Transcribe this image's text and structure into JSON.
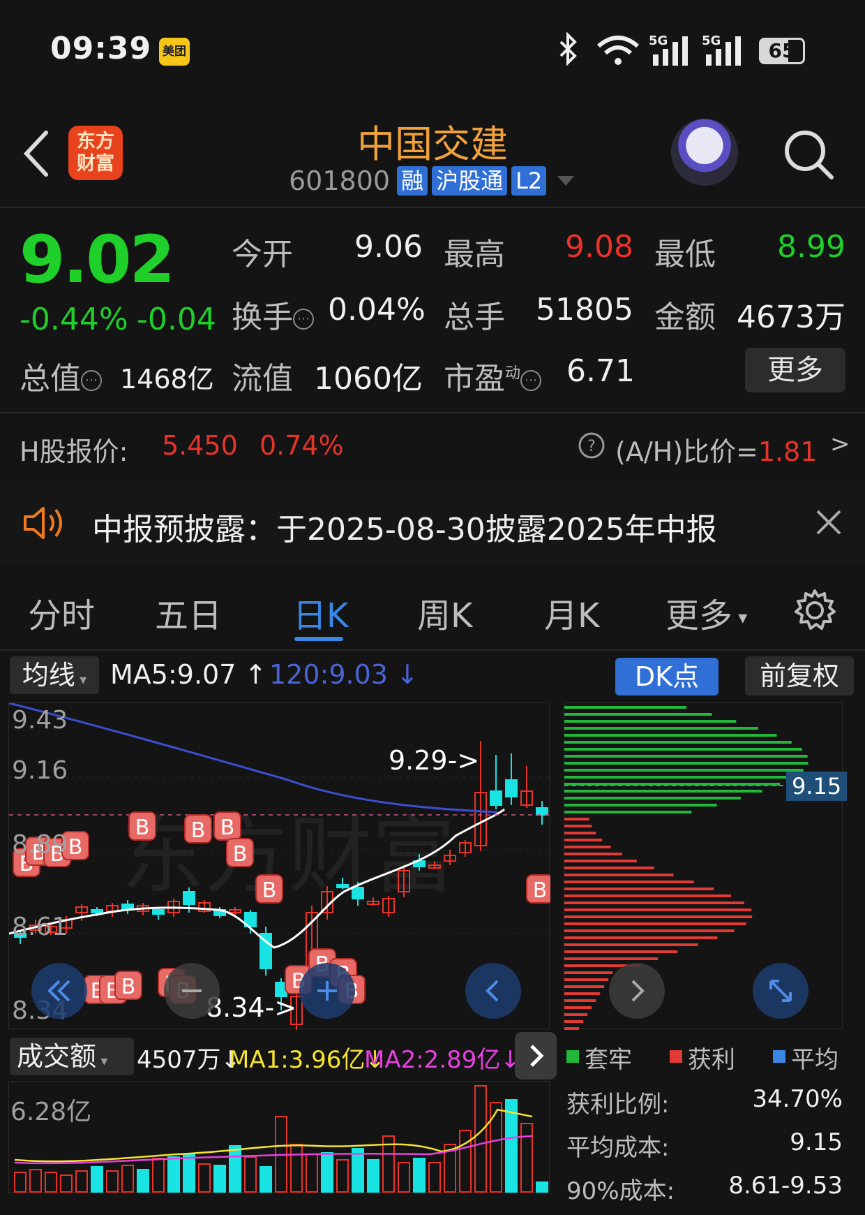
{
  "status_bar": {
    "time": "09:39",
    "app_badge": "美团",
    "battery": "65",
    "battery_level": 0.65,
    "net1": "5G",
    "net2": "5G"
  },
  "header": {
    "logo_line1": "东方",
    "logo_line2": "财富",
    "stock_name": "中国交建",
    "stock_code": "601800",
    "tags": [
      "融",
      "沪股通",
      "L2"
    ]
  },
  "quote": {
    "price": "9.02",
    "change_pct": "-0.44%",
    "change": "-0.04",
    "open_label": "今开",
    "open": "9.06",
    "high_label": "最高",
    "high": "9.08",
    "low_label": "最低",
    "low": "8.99",
    "turnover_label": "换手",
    "turnover": "0.04%",
    "volume_label": "总手",
    "volume": "51805",
    "amount_label": "金额",
    "amount": "4673万",
    "mktcap_label": "总值",
    "mktcap": "1468亿",
    "float_label": "流值",
    "float_cap": "1060亿",
    "pe_label": "市盈",
    "pe_sup": "动",
    "pe": "6.71",
    "more_label": "更多"
  },
  "hshare": {
    "label": "H股报价:",
    "price": "5.450",
    "pct": "0.74%",
    "ah_label": "(A/H)比价=",
    "ah_value": "1.81",
    "arrow": ">"
  },
  "notice": {
    "text": "中报预披露：于2025-08-30披露2025年中报"
  },
  "tabs": [
    {
      "label": "分时"
    },
    {
      "label": "五日"
    },
    {
      "label": "日K"
    },
    {
      "label": "周K"
    },
    {
      "label": "月K"
    },
    {
      "label": "更多"
    }
  ],
  "chart_controls": {
    "ma_selector": "均线",
    "ma5": "MA5:9.07 ↑",
    "ma120": "120:9.03 ↓",
    "dk_button": "DK点",
    "adjust_button": "前复权"
  },
  "kline_labels": {
    "y_top": "9.43",
    "y2": "9.16",
    "y3": "8.89",
    "y4": "8.61",
    "y_bottom": "8.34",
    "max_marker": "9.29->",
    "min_marker": "8.34->",
    "current_cost": "9.15"
  },
  "volume_panel": {
    "selector": "成交额",
    "current": "4507万↓",
    "ma1": "MA1:3.96亿↓",
    "ma2": "MA2:2.89亿↓",
    "y_max": "6.28亿"
  },
  "legend": [
    {
      "label": "套牢",
      "color": "#22b83a"
    },
    {
      "label": "获利",
      "color": "#e23a35"
    },
    {
      "label": "平均",
      "color": "#3a87e6"
    }
  ],
  "cost_stats": [
    {
      "label": "获利比例:",
      "value": "34.70%"
    },
    {
      "label": "平均成本:",
      "value": "9.15"
    },
    {
      "label": "90%成本:",
      "value": "8.61-9.53"
    }
  ],
  "colors": {
    "up": "#e8332a",
    "down": "#1fcf2a",
    "accent": "#f2a23a",
    "tab_active": "#3a87e6"
  }
}
